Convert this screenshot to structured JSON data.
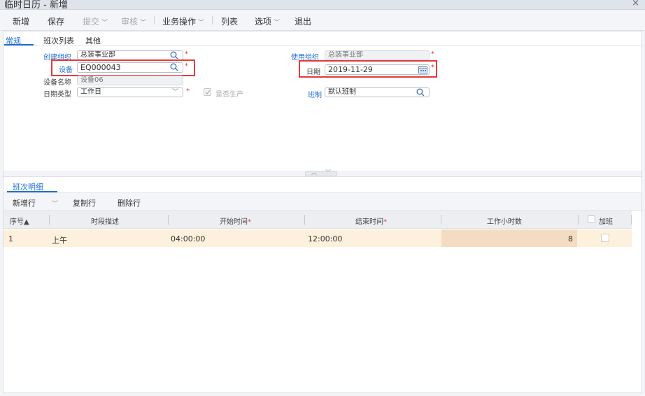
{
  "window": {
    "title": "临时日历 - 新增",
    "close_glyph": "×"
  },
  "toolbar": {
    "new": "新增",
    "save": "保存",
    "submit": "提交",
    "audit": "审核",
    "business_ops": "业务操作",
    "list": "列表",
    "options": "选项",
    "exit": "退出"
  },
  "tabs": [
    "常规",
    "班次列表",
    "其他"
  ],
  "form": {
    "create_org_label": "创建组织",
    "create_org_value": "总装事业部",
    "use_org_label": "使用组织",
    "use_org_value": "总装事业部",
    "device_label": "设备",
    "device_value": "EQ000043",
    "date_label": "日期",
    "date_value": "2019-11-29",
    "device_name_label": "设备名称",
    "device_name_value": "设备06",
    "date_type_label": "日期类型",
    "date_type_value": "工作日",
    "is_production_label": "是否生产",
    "shift_label": "班制",
    "shift_value": "默认班制",
    "required_mark": "*"
  },
  "detail": {
    "tab": "班次明细",
    "toolbar": {
      "add_row": "新增行",
      "copy_row": "复制行",
      "delete_row": "删除行"
    },
    "columns": {
      "seq": "序号▲",
      "period": "时段描述",
      "start": "开始时间",
      "end": "结束时间",
      "hours": "工作小时数",
      "overtime": "加班"
    },
    "rows": [
      {
        "seq": "1",
        "period": "上午",
        "start": "04:00:00",
        "end": "12:00:00",
        "hours": "8",
        "overtime": false
      }
    ]
  },
  "colors": {
    "accent": "#1e6fd1",
    "highlight_box": "#e23b3b",
    "row_selected": "#fdf0dc"
  }
}
